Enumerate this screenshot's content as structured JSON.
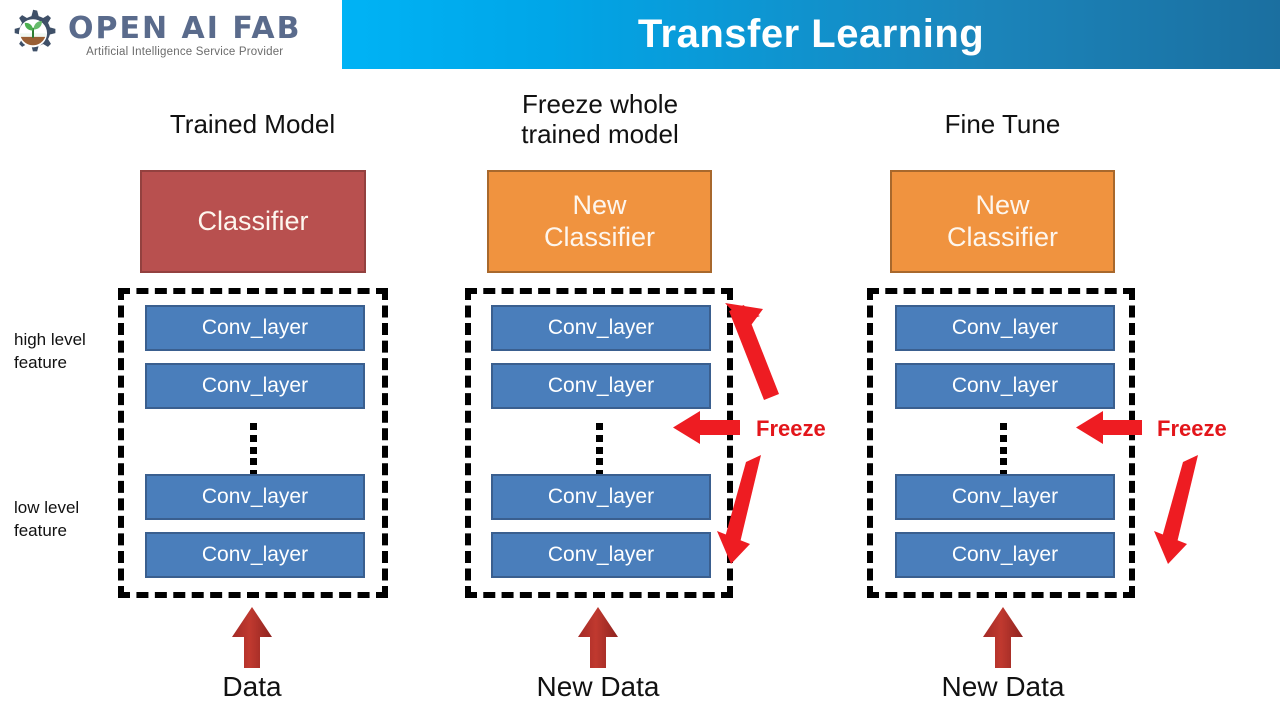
{
  "header": {
    "logo_wordmark": "OPEN AI FAB",
    "logo_tagline": "Artificial Intelligence Service Provider",
    "title": "Transfer Learning",
    "gradient_start": "#00b3f5",
    "gradient_end": "#1b6fa0"
  },
  "side_labels": {
    "high": "high level\nfeature",
    "high_line1": "high level",
    "high_line2": "feature",
    "low_line1": "low level",
    "low_line2": "feature"
  },
  "colors": {
    "conv_fill": "#4a7ebb",
    "conv_border": "#3a5f8f",
    "classifier_red": "#b8504f",
    "classifier_orange": "#f0933f",
    "freeze_red": "#e3161b",
    "data_arrow_red": "#b0302c",
    "dashed_black": "#000000"
  },
  "columns": [
    {
      "id": "trained-model",
      "heading": "Trained Model",
      "heading_lines": [
        "Trained Model"
      ],
      "classifier_label": "Classifier",
      "classifier_style": "red",
      "conv_layers": [
        "Conv_layer",
        "Conv_layer",
        "Conv_layer",
        "Conv_layer"
      ],
      "has_ellipsis": true,
      "data_label": "Data",
      "freeze_label": null,
      "arrows": [
        "data-up"
      ]
    },
    {
      "id": "freeze-whole",
      "heading": "Freeze whole trained model",
      "heading_lines": [
        "Freeze whole",
        "trained model"
      ],
      "classifier_label": "New Classifier",
      "classifier_lines": [
        "New",
        "Classifier"
      ],
      "classifier_style": "orange",
      "conv_layers": [
        "Conv_layer",
        "Conv_layer",
        "Conv_layer",
        "Conv_layer"
      ],
      "has_ellipsis": true,
      "data_label": "New Data",
      "freeze_label": "Freeze",
      "arrows": [
        "freeze-up-left",
        "freeze-left",
        "freeze-down-right",
        "data-up"
      ]
    },
    {
      "id": "fine-tune",
      "heading": "Fine Tune",
      "heading_lines": [
        "Fine Tune"
      ],
      "classifier_label": "New Classifier",
      "classifier_lines": [
        "New",
        "Classifier"
      ],
      "classifier_style": "orange",
      "conv_layers": [
        "Conv_layer",
        "Conv_layer",
        "Conv_layer",
        "Conv_layer"
      ],
      "has_ellipsis": true,
      "data_label": "New Data",
      "freeze_label": "Freeze",
      "arrows": [
        "freeze-left",
        "freeze-down-right",
        "data-up"
      ]
    }
  ]
}
